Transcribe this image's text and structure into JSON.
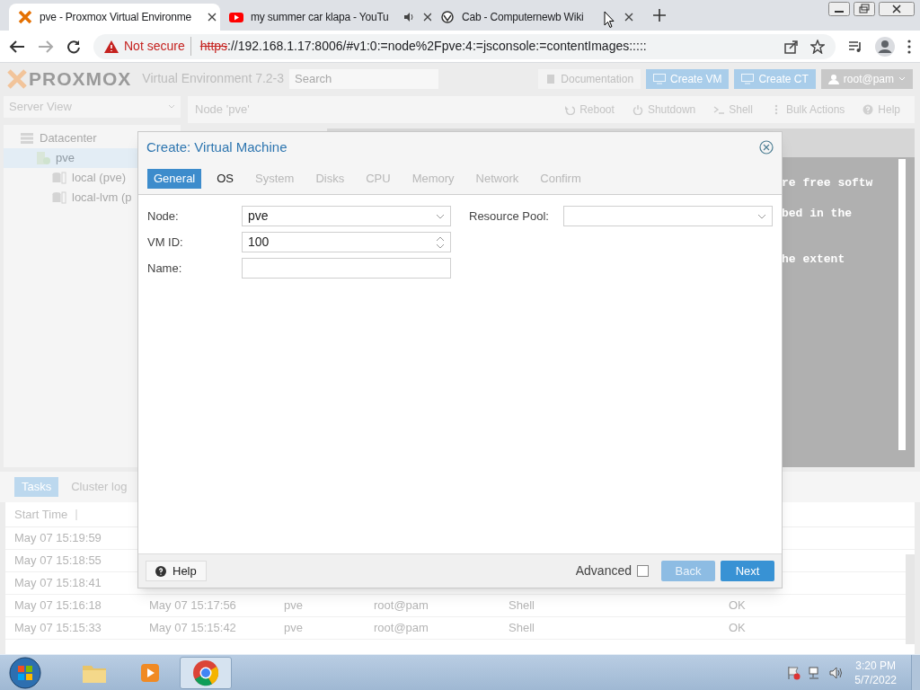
{
  "browser": {
    "tabs": [
      {
        "title": "pve - Proxmox Virtual Environme",
        "kind": "proxmox",
        "selected": true,
        "audio": false
      },
      {
        "title": "my summer car klapa - YouTu",
        "kind": "video",
        "selected": false,
        "audio": true
      },
      {
        "title": "Cab - Computernewb Wiki",
        "kind": "wiki",
        "selected": false,
        "audio": false
      }
    ],
    "security": "Not secure",
    "url_scheme": "https",
    "url_rest": "://192.168.1.17:8006/#v1:0:=node%2Fpve:4:=jsconsole:=contentImages:::::"
  },
  "header": {
    "logo": "PROXMOX",
    "version": "Virtual Environment 7.2-3",
    "search_placeholder": "Search",
    "buttons": [
      {
        "label": "Documentation",
        "kind": "plain"
      },
      {
        "label": "Create VM",
        "kind": "primary"
      },
      {
        "label": "Create CT",
        "kind": "primary"
      },
      {
        "label": "root@pam",
        "kind": "user"
      }
    ]
  },
  "sidebar": {
    "view": "Server View",
    "tree": [
      {
        "label": "Datacenter",
        "kind": "datacenter",
        "selected": false,
        "children": [
          {
            "label": "pve",
            "kind": "node",
            "selected": true,
            "children": [
              {
                "label": "local (pve)",
                "kind": "storage",
                "selected": false
              },
              {
                "label": "local-lvm (p",
                "kind": "storage",
                "selected": false
              }
            ]
          }
        ]
      }
    ]
  },
  "node_toolbar": {
    "title": "Node 'pve'",
    "buttons": [
      {
        "label": "Reboot",
        "kind": "reboot"
      },
      {
        "label": "Shutdown",
        "kind": "power"
      },
      {
        "label": "Shell",
        "kind": "terminal"
      },
      {
        "label": "Bulk Actions",
        "kind": "menu"
      },
      {
        "label": "Help",
        "kind": "help"
      }
    ]
  },
  "console": {
    "lines": [
      "re free softw",
      "bed in the",
      "he extent"
    ]
  },
  "dialog": {
    "title": "Create: Virtual Machine",
    "tabs": [
      {
        "label": "General",
        "selected": true,
        "disabled": false
      },
      {
        "label": "OS",
        "selected": false,
        "disabled": false
      },
      {
        "label": "System",
        "selected": false,
        "disabled": true
      },
      {
        "label": "Disks",
        "selected": false,
        "disabled": true
      },
      {
        "label": "CPU",
        "selected": false,
        "disabled": true
      },
      {
        "label": "Memory",
        "selected": false,
        "disabled": true
      },
      {
        "label": "Network",
        "selected": false,
        "disabled": true
      },
      {
        "label": "Confirm",
        "selected": false,
        "disabled": true
      }
    ],
    "left_fields": [
      {
        "label": "Node:",
        "kind": "combo",
        "value": "pve"
      },
      {
        "label": "VM ID:",
        "kind": "spinner",
        "value": "100"
      },
      {
        "label": "Name:",
        "kind": "text"
      }
    ],
    "right_fields": [
      {
        "label": "Resource Pool:",
        "kind": "combo"
      }
    ],
    "help": "Help",
    "advanced": {
      "label": "Advanced",
      "checked": false
    },
    "buttons": [
      {
        "label": "Back",
        "disabled": true
      },
      {
        "label": "Next",
        "disabled": false
      }
    ]
  },
  "tasks": {
    "tabs": [
      {
        "label": "Tasks",
        "selected": true
      },
      {
        "label": "Cluster log",
        "selected": false
      }
    ],
    "sort_column": "Start Time",
    "rows": [
      {
        "start_time": "May 07 15:19:59"
      },
      {
        "start_time": "May 07 15:18:55"
      },
      {
        "start_time": "May 07 15:18:41"
      },
      {
        "start_time": "May 07 15:16:18",
        "end_time": "May 07 15:17:56",
        "node": "pve",
        "user": "root@pam",
        "description": "Shell",
        "status": "OK"
      },
      {
        "start_time": "May 07 15:15:33",
        "end_time": "May 07 15:15:42",
        "node": "pve",
        "user": "root@pam",
        "description": "Shell",
        "status": "OK"
      }
    ]
  },
  "taskbar": {
    "apps": [
      {
        "kind": "folder",
        "active": false
      },
      {
        "kind": "media",
        "active": false
      },
      {
        "kind": "chrome",
        "active": true
      }
    ],
    "time": "3:20 PM",
    "date": "5/7/2022"
  }
}
